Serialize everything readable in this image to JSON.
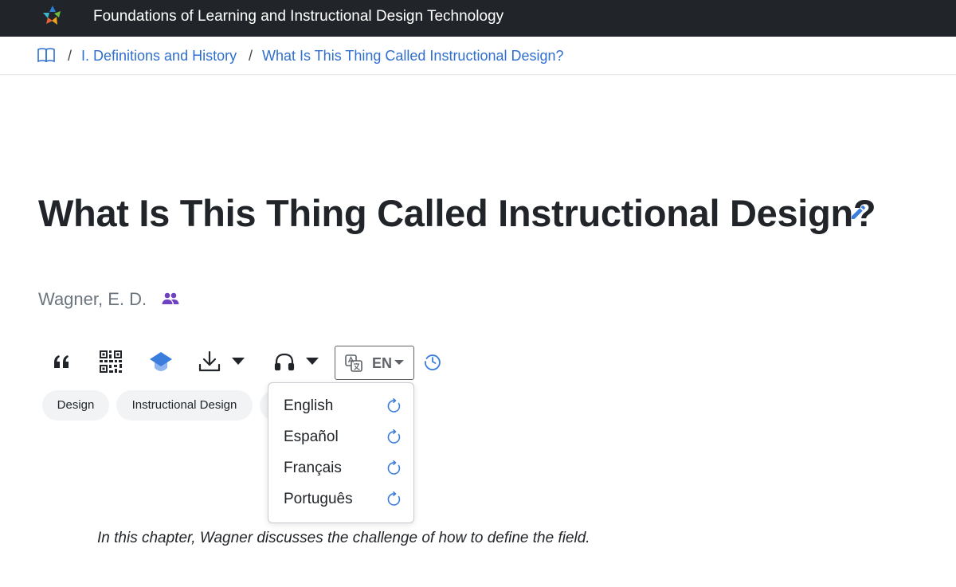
{
  "header": {
    "site_title": "Foundations of Learning and Instructional Design Technology",
    "logo_icon": "pinwheel-logo"
  },
  "breadcrumb": {
    "home_icon": "book-icon",
    "separator": "/",
    "items": [
      {
        "label": "I. Definitions and History"
      },
      {
        "label": "What Is This Thing Called Instructional Design?"
      }
    ]
  },
  "page": {
    "title": "What Is This Thing Called Instructional Design?",
    "author": "Wagner, E. D.",
    "summary": "In this chapter, Wagner discusses the challenge of how to define the field."
  },
  "toolbar": {
    "icons": [
      "quote-icon",
      "qr-code-icon",
      "mortarboard-icon",
      "download-icon",
      "headphones-icon",
      "translate-icon",
      "history-icon"
    ],
    "language_code": "EN"
  },
  "tags": [
    "Design",
    "Instructional Design"
  ],
  "language_menu": {
    "options": [
      {
        "label": "English"
      },
      {
        "label": "Español"
      },
      {
        "label": "Français"
      },
      {
        "label": "Português"
      }
    ]
  },
  "colors": {
    "header_bg": "#212529",
    "link": "#2f6fcf",
    "accent_blue": "#3b7ddd",
    "muted": "#6c757d",
    "tag_bg": "#f1f3f4",
    "people_icon": "#6f42c1"
  }
}
